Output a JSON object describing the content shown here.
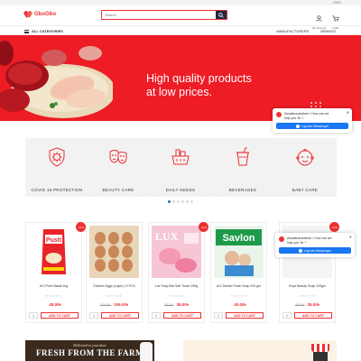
{
  "topbar": {
    "language": "ENG"
  },
  "header": {
    "logo_text": "GboGbo",
    "search_placeholder": "Search",
    "account_label": "My account",
    "cart_label": "0.00৳",
    "brand_color": "#ee2e31"
  },
  "nav": {
    "all_categories": "ALL CATEGORIES",
    "links": [
      "MANUFACTURERS",
      "BRANDS"
    ]
  },
  "banner": {
    "headline_line1": "High quality products",
    "headline_line2": "at low prices.",
    "background_color": "#ee1c25"
  },
  "messenger": {
    "greeting": "Assalamualaikum ! How can we help you Sir ?",
    "button": "Log into Messenger"
  },
  "categories": [
    {
      "label": "COVID 19 PROTECTION",
      "icon": "virus-shield-icon"
    },
    {
      "label": "BEAUTY CARE",
      "icon": "masks-icon"
    },
    {
      "label": "DAILY NEEDS",
      "icon": "grocery-basket-icon"
    },
    {
      "label": "BEVERAGES",
      "icon": "drink-cup-icon"
    },
    {
      "label": "BABY CARE",
      "icon": "baby-face-icon"
    }
  ],
  "carousel": {
    "pages": 6,
    "active": 0
  },
  "products": [
    {
      "name": "ACI Pure Maida 1kg",
      "old_price": "",
      "price": "48.00৳",
      "discount": ""
    },
    {
      "name": "Chicken Eggs (Layer) 12 PCS",
      "old_price": "115.00৳",
      "price": "106.00৳",
      "discount": ""
    },
    {
      "name": "Lux Soap Bar Soft Touch 150g",
      "old_price": "38.00৳",
      "price": "35.00৳",
      "discount": "-11%"
    },
    {
      "name": "ACI Savlon Fresh Soap 100 gm",
      "old_price": "",
      "price": "40.00৳",
      "discount": ""
    },
    {
      "name": "Keya Beauty Soap 125gm",
      "old_price": "38.00৳",
      "price": "35.00৳",
      "discount": "-11%"
    }
  ],
  "first_product_discount": "-11%",
  "product_ui": {
    "add_to_cart": "ADD TO CART",
    "qty": "1",
    "stars": "★★★★★"
  },
  "lower_banner": {
    "tagline": "Delivered to your door",
    "headline": "FRESH FROM THE FARM"
  }
}
